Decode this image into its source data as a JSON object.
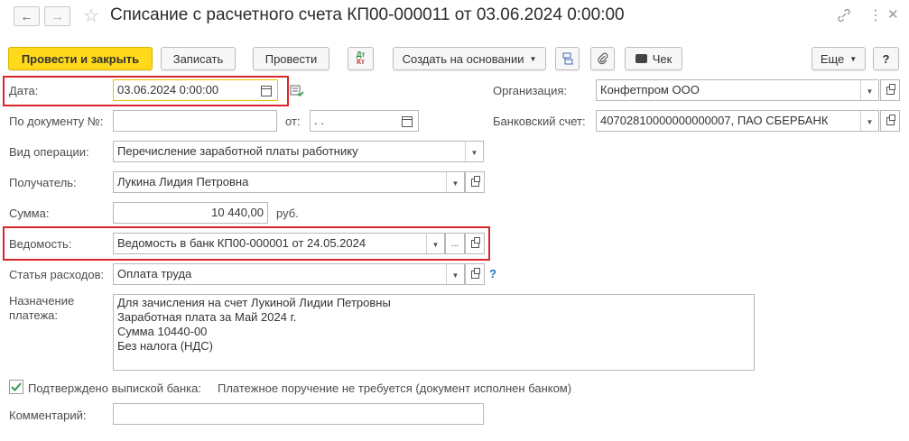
{
  "window": {
    "title": "Списание с расчетного счета КП00-000011 от 03.06.2024 0:00:00",
    "back_icon": "←",
    "forward_icon": "→",
    "star_icon": "☆",
    "link_icon": "🔗",
    "menu_icon": "⋮",
    "close_icon": "✕"
  },
  "toolbar": {
    "post_and_close": "Провести и закрыть",
    "save": "Записать",
    "post": "Провести",
    "dtkt_top": "Дт",
    "dtkt_bottom": "Кт",
    "create_based_on": "Создать на основании",
    "receipt": "Чек",
    "more": "Еще",
    "help": "?"
  },
  "form": {
    "date_label": "Дата:",
    "date_value": "03.06.2024  0:00:00",
    "organization_label": "Организация:",
    "organization_value": "Конфетпром ООО",
    "doc_number_label": "По документу №:",
    "doc_number_value": "",
    "from_label": "от:",
    "from_value": " .  .",
    "bank_account_label": "Банковский счет:",
    "bank_account_value": "40702810000000000007, ПАО СБЕРБАНК",
    "operation_label": "Вид операции:",
    "operation_value": "Перечисление заработной платы работнику",
    "recipient_label": "Получатель:",
    "recipient_value": "Лукина Лидия Петровна",
    "amount_label": "Сумма:",
    "amount_value": "10 440,00",
    "currency": "руб.",
    "statement_label": "Ведомость:",
    "statement_value": "Ведомость в банк КП00-000001 от 24.05.2024",
    "expense_label": "Статья расходов:",
    "expense_value": "Оплата труда",
    "expense_help": "?",
    "purpose_label_1": "Назначение",
    "purpose_label_2": "платежа:",
    "purpose_lines": [
      "Для зачисления на счет Лукиной Лидии Петровны",
      "Заработная плата за Май 2024 г.",
      "Сумма 10440-00",
      "Без налога (НДС)"
    ],
    "confirmed_label": "Подтверждено выпиской банка:",
    "confirmed_checked": true,
    "confirmed_note": "Платежное поручение не требуется (документ исполнен банком)",
    "comment_label": "Комментарий:",
    "comment_value": ""
  },
  "colors": {
    "primary_button": "#ffd91a",
    "highlight": "#d9262b",
    "active_field_border": "#e8c100",
    "check": "#2e9e4f",
    "help": "#2a6fb5"
  }
}
